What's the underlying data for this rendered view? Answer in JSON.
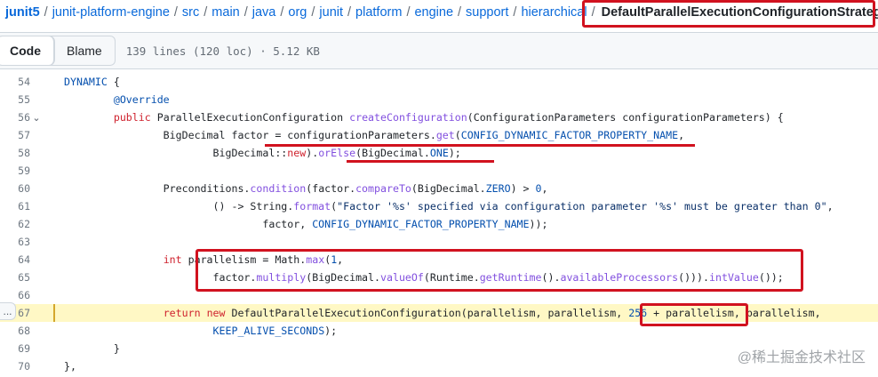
{
  "breadcrumb": {
    "parts": [
      "junit5",
      "junit-platform-engine",
      "src",
      "main",
      "java",
      "org",
      "junit",
      "platform",
      "engine",
      "support",
      "hierarchical"
    ],
    "separator": "/",
    "file": "DefaultParallelExecutionConfigurationStrategy.java"
  },
  "file_header": {
    "tabs": [
      "Code",
      "Blame"
    ],
    "active_tab": "Code",
    "meta": "139 lines (120 loc) · 5.12 KB"
  },
  "code": {
    "lines": [
      {
        "n": "54",
        "text": "        DYNAMIC {"
      },
      {
        "n": "55",
        "text": "                @Override"
      },
      {
        "n": "56",
        "text": "                public ParallelExecutionConfiguration createConfiguration(ConfigurationParameters configurationParameters) {"
      },
      {
        "n": "57",
        "text": "                        BigDecimal factor = configurationParameters.get(CONFIG_DYNAMIC_FACTOR_PROPERTY_NAME,"
      },
      {
        "n": "58",
        "text": "                                BigDecimal::new).orElse(BigDecimal.ONE);"
      },
      {
        "n": "59",
        "text": ""
      },
      {
        "n": "60",
        "text": "                        Preconditions.condition(factor.compareTo(BigDecimal.ZERO) > 0,"
      },
      {
        "n": "61",
        "text": "                                () -> String.format(\"Factor '%s' specified via configuration parameter '%s' must be greater than 0\","
      },
      {
        "n": "62",
        "text": "                                        factor, CONFIG_DYNAMIC_FACTOR_PROPERTY_NAME));"
      },
      {
        "n": "63",
        "text": ""
      },
      {
        "n": "64",
        "text": "                        int parallelism = Math.max(1,"
      },
      {
        "n": "65",
        "text": "                                factor.multiply(BigDecimal.valueOf(Runtime.getRuntime().availableProcessors())).intValue());"
      },
      {
        "n": "66",
        "text": ""
      },
      {
        "n": "67",
        "text": "                        return new DefaultParallelExecutionConfiguration(parallelism, parallelism, 256 + parallelism, parallelism,"
      },
      {
        "n": "68",
        "text": "                                KEEP_ALIVE_SECONDS);"
      },
      {
        "n": "69",
        "text": "                }"
      },
      {
        "n": "70",
        "text": "        },"
      }
    ],
    "fold_line": "56",
    "highlighted_line": "67",
    "expand_label": "..."
  },
  "watermark": "@稀土掘金技术社区",
  "colors": {
    "annotation_red": "#d1121f",
    "link_blue": "#0969da",
    "highlight_bg": "#fff8c5"
  }
}
